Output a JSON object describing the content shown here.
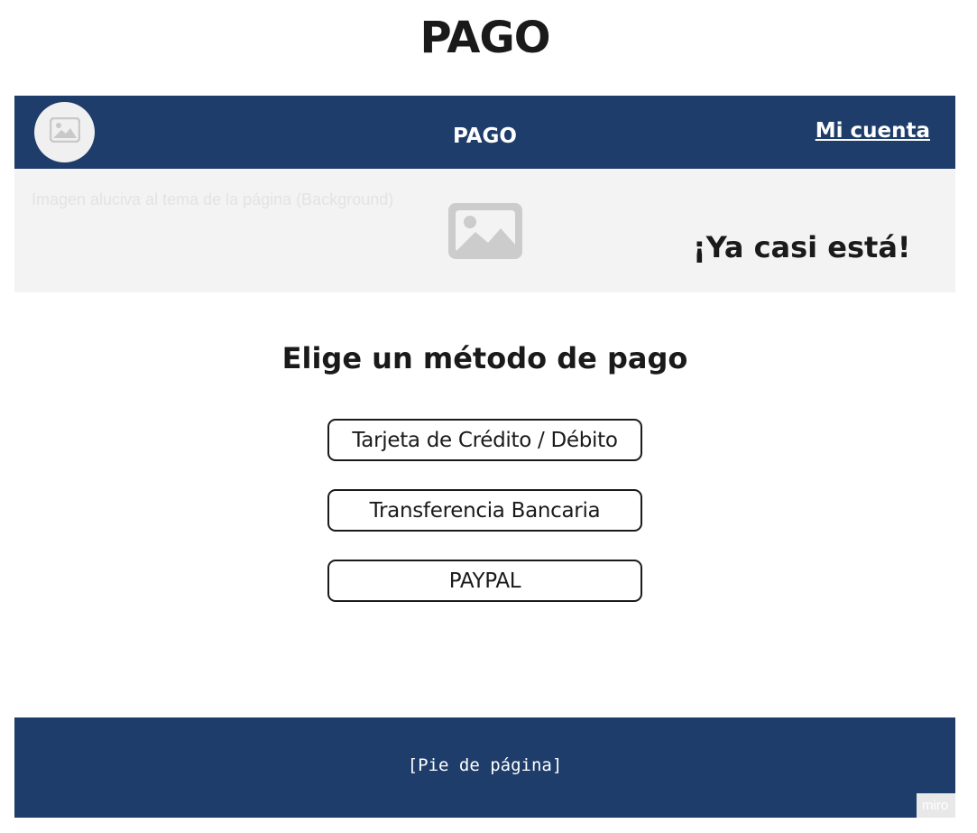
{
  "page": {
    "title": "PAGO"
  },
  "navbar": {
    "logo_icon": "image-placeholder-icon",
    "title": "PAGO",
    "account_link": "Mi cuenta",
    "background_color": "#1e3d6b"
  },
  "hero": {
    "caption": "Imagen aluciva al tema de la página (Background)",
    "image_icon": "image-placeholder-icon",
    "tagline": "¡Ya casi está!"
  },
  "main": {
    "heading": "Elige un método de pago",
    "payment_methods": [
      {
        "label": "Tarjeta de Crédito / Débito"
      },
      {
        "label": "Transferencia Bancaria"
      },
      {
        "label": "PAYPAL"
      }
    ]
  },
  "footer": {
    "text": "[Pie de página]"
  },
  "watermark": {
    "text": "miro"
  }
}
